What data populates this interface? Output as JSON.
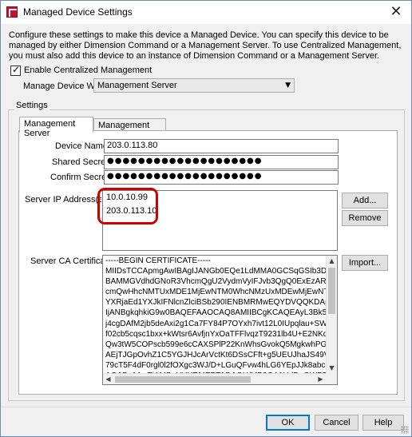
{
  "window": {
    "title": "Managed Device Settings",
    "close_glyph": "✕"
  },
  "description": "Configure these settings to make this device a Managed Device. You can specify this device to be managed by either Dimension Command or a Management Server. To use Centralized Management, you must also add this device to an instance of Dimension Command or a Management Server.",
  "centralized": {
    "label": "Enable Centralized Management",
    "checked": true
  },
  "manage_with": {
    "label": "Manage Device With",
    "selected": "Management Server"
  },
  "settings": {
    "group_label": "Settings",
    "tabs": [
      {
        "label": "Management Server",
        "active": true
      },
      {
        "label": "Management Tunnel",
        "active": false
      }
    ]
  },
  "form": {
    "device_name_label": "Device Name:",
    "device_name_value": "203.0.113.80",
    "shared_secret_label": "Shared Secret:",
    "shared_secret_value": "●●●●●●●●●●●●●●●●●●●●",
    "confirm_secret_label": "Confirm Secret:",
    "confirm_secret_value": "●●●●●●●●●●●●●●●●●●●●",
    "server_ip_label": "Server IP Address(es):",
    "server_ips": [
      "10.0.10.99",
      "203.0.113.10"
    ],
    "add_button": "Add...",
    "remove_button": "Remove",
    "ca_label": "Server CA Certificate:",
    "import_button": "Import...",
    "cert_text": "-----BEGIN CERTIFICATE-----\nMIIDsTCCApmgAwIBAgIJANGb0EQe1LdMMA0GCSqGSIb3DQEBCw\nBAMMGVdhdGNoR3VhcmQgU2VydmVyIFJvb3QgQ0ExEzARBgNVE\ncmQwHhcNMTUxMDE1MjEwNTM0WhcNMzUxMDEwMjEwNTM0WjA\nYXRjaEd1YXJkIFNlcnZlciBSb290IENBMRMwEQYDVQQKDApXYXRjaE\nIjANBgkqhkiG9w0BAQEFAAOCAQ8AMIIBCgKCAQEAyL3Bk5h6TkHr\nj4cgDAfM2jb5deAxi2g1Ca7FY84P7OYxh7ivt12L0IUpqlau+SWwtMN\nf02cb5cqsc1bxx+kWtsr6AvfjnYxOaTFFlvqzT9231lb4U+E2NKq2wdV\nQw3tW5COPscb599e6cCAXSPlP22KnWhsGvokQ5MgkwhPGudb88\nAEjTJGpOvhZ1C5YGJHJcArVctKt6DSsCFft+g5UEUJhaJS49VdCTAV\n79cT5F4dF0rgl0l2fOXgc3WJ/D+LGuQFvw4hLG6YEpJJk8abcbQXaC\nAQABo1AwTjAMBgNVHRMEBTADAQH/MB0GA1UdDgQWBBQ9ZXCY"
  },
  "buttons": {
    "ok": "OK",
    "cancel": "Cancel",
    "help": "Help"
  },
  "colors": {
    "highlight_ring": "#d00000",
    "default_button_border": "#0078d7"
  }
}
